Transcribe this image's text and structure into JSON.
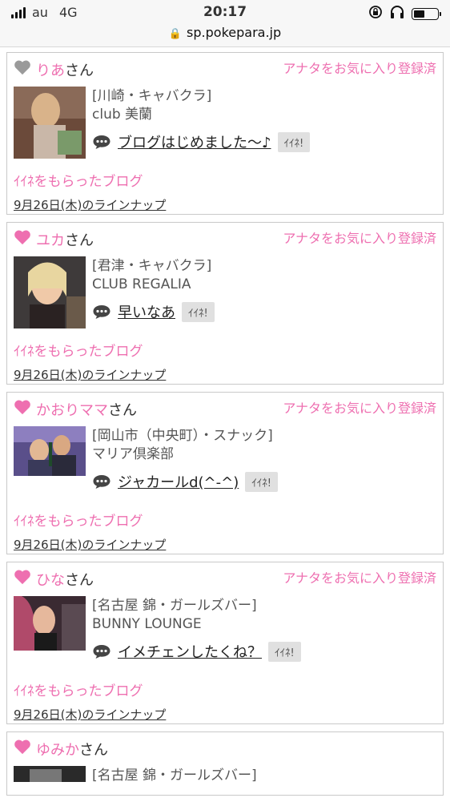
{
  "status": {
    "carrier": "au",
    "network": "4G",
    "time": "20:17"
  },
  "browser": {
    "url": "sp.pokepara.jp"
  },
  "labels": {
    "san": "さん",
    "fav_registered": "アナタをお気に入り登録済",
    "iine": "ｲｲﾈ!",
    "liked_blog": "ｲｲﾈをもらったブログ",
    "lineup": "9月26日(木)のラインナップ"
  },
  "colors": {
    "accent": "#ee6fb0",
    "heart_gray": "#9a9a9a"
  },
  "cards": [
    {
      "name": "りあ",
      "heart": "gray",
      "area": "[川崎・キャバクラ]",
      "shop": "club 美蘭",
      "blog": "ブログはじめました〜♪"
    },
    {
      "name": "ユカ",
      "heart": "pink",
      "area": "[君津・キャバクラ]",
      "shop": "CLUB REGALIA",
      "blog": "早いなあ"
    },
    {
      "name": "かおりママ",
      "heart": "pink",
      "area": "[岡山市（中央町）・スナック]",
      "shop": "マリア倶楽部",
      "blog": "ジャカールd(^-^)"
    },
    {
      "name": "ひな",
      "heart": "pink",
      "area": "[名古屋 錦・ガールズバー]",
      "shop": "BUNNY LOUNGE",
      "blog": "イメチェンしたくね？"
    },
    {
      "name": "ゆみか",
      "heart": "pink",
      "area": "[名古屋 錦・ガールズバー]"
    }
  ]
}
